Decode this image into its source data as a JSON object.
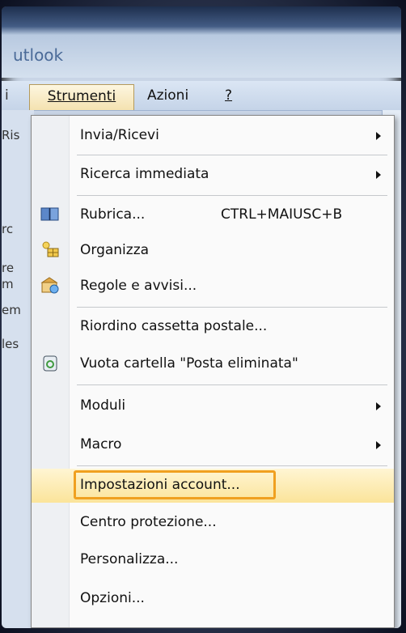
{
  "app": {
    "title": "utlook"
  },
  "menubar": {
    "cut_item": "i",
    "items": [
      {
        "label": "Strumenti",
        "underline": "S"
      },
      {
        "label": "Azioni",
        "underline": "i"
      },
      {
        "label": "?",
        "underline": "?"
      }
    ]
  },
  "left_fragments": [
    "Ris",
    "rc",
    "re",
    "m",
    "em",
    "les"
  ],
  "dropdown": {
    "items": [
      {
        "label": "Invia/Ricevi",
        "submenu": true
      },
      {
        "label": "Ricerca immediata",
        "submenu": true
      },
      {
        "label": "Rubrica...",
        "shortcut": "CTRL+MAIUSC+B",
        "icon": "address-book-icon"
      },
      {
        "label": "Organizza",
        "icon": "organize-icon"
      },
      {
        "label": "Regole e avvisi...",
        "icon": "rules-icon"
      },
      {
        "label": "Riordino cassetta postale..."
      },
      {
        "label": "Vuota cartella \"Posta eliminata\"",
        "icon": "recycle-bin-icon"
      },
      {
        "label": "Moduli",
        "submenu": true
      },
      {
        "label": "Macro",
        "submenu": true
      },
      {
        "label": "Impostazioni account...",
        "highlighted": true
      },
      {
        "label": "Centro protezione..."
      },
      {
        "label": "Personalizza..."
      },
      {
        "label": "Opzioni..."
      }
    ]
  },
  "colors": {
    "highlight_border": "#f0a020",
    "highlight_fill": "#fbe49a"
  }
}
